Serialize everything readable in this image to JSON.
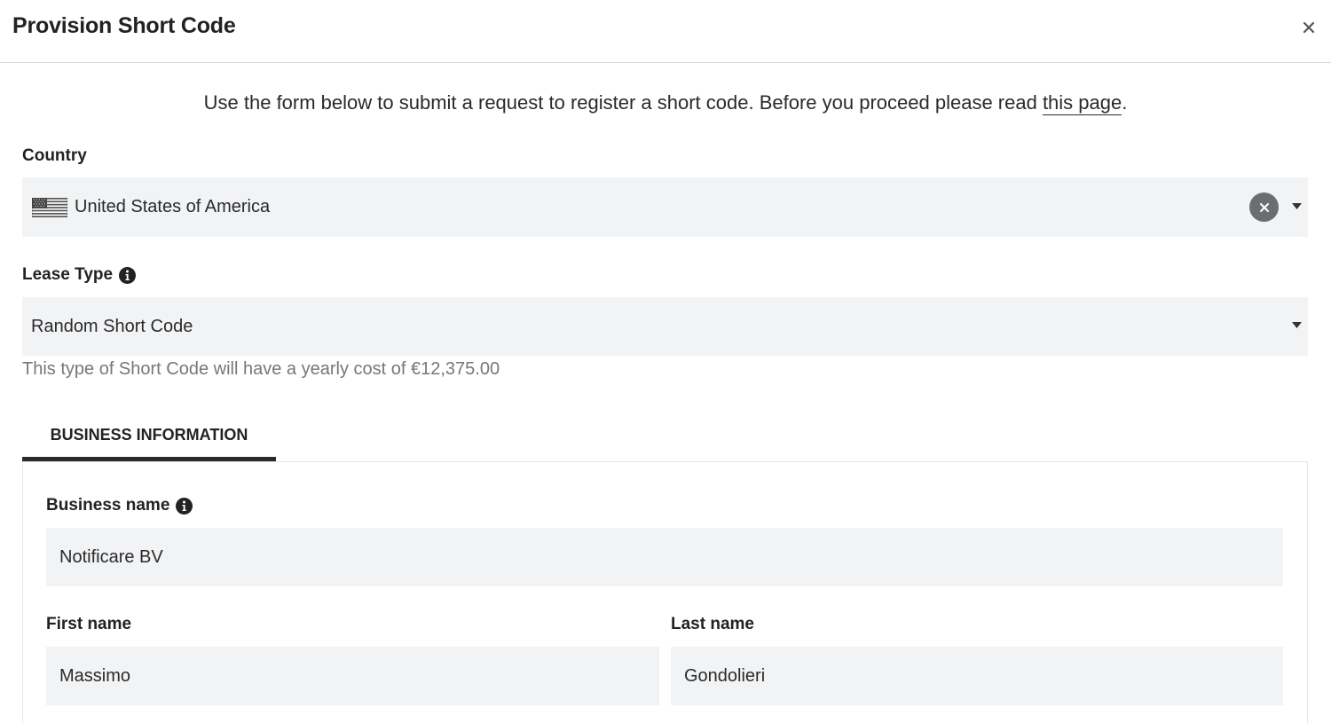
{
  "dialog": {
    "title": "Provision Short Code"
  },
  "intro": {
    "text": "Use the form below to submit a request to register a short code. Before you proceed please read ",
    "link": "this page",
    "suffix": "."
  },
  "country": {
    "label": "Country",
    "value": "United States of America",
    "flag_icon": "us-flag-icon"
  },
  "lease_type": {
    "label": "Lease Type",
    "value": "Random Short Code",
    "hint": "This type of Short Code will have a yearly cost of €12,375.00"
  },
  "tabs": [
    {
      "label": "BUSINESS INFORMATION",
      "active": true
    }
  ],
  "business": {
    "name_label": "Business name",
    "name_value": "Notificare BV",
    "first_name_label": "First name",
    "first_name_value": "Massimo",
    "last_name_label": "Last name",
    "last_name_value": "Gondolieri"
  },
  "colors": {
    "field_bg": "#f2f3f5",
    "text": "#2a2a2a",
    "muted": "#777777",
    "tab_underline": "#2a2a2a"
  }
}
